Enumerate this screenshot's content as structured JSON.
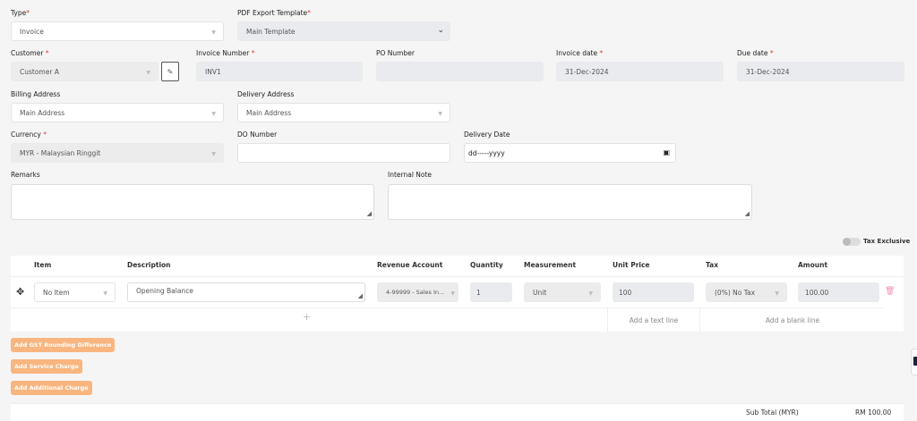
{
  "form": {
    "type": {
      "label": "Type",
      "value": "Invoice"
    },
    "pdf_template": {
      "label": "PDF Export Template",
      "value": "Main Template"
    },
    "customer": {
      "label": "Customer",
      "value": "Customer A"
    },
    "invoice_number": {
      "label": "Invoice Number",
      "value": "INV1"
    },
    "po_number": {
      "label": "PO Number",
      "value": ""
    },
    "invoice_date": {
      "label": "Invoice date",
      "value": "31-Dec-2024"
    },
    "due_date": {
      "label": "Due date",
      "value": "31-Dec-2024"
    },
    "billing_address": {
      "label": "Billing Address",
      "value": "Main Address"
    },
    "delivery_address": {
      "label": "Delivery Address",
      "value": "Main Address"
    },
    "currency": {
      "label": "Currency",
      "value": "MYR - Malaysian Ringgit"
    },
    "do_number": {
      "label": "DO Number",
      "value": ""
    },
    "delivery_date": {
      "label": "Delivery Date",
      "value": "dd-----yyyy"
    },
    "remarks": {
      "label": "Remarks",
      "value": ""
    },
    "internal_note": {
      "label": "Internal Note",
      "value": ""
    },
    "required_mark": "*"
  },
  "tax_toggle": {
    "label": "Tax Exclusive",
    "on": false
  },
  "table": {
    "headers": [
      "Item",
      "Description",
      "Revenue Account",
      "Quantity",
      "Measurement",
      "Unit Price",
      "Tax",
      "Amount"
    ],
    "rows": [
      {
        "item": "No Item",
        "description": "Opening Balance",
        "account": "4-99999 - Sales In...",
        "quantity": "1",
        "measurement": "Unit",
        "unit_price": "100",
        "tax": "(0%) No Tax",
        "amount": "100.00"
      }
    ],
    "add_text_line": "Add a text line",
    "add_blank_line": "Add a blank line"
  },
  "buttons": {
    "gst": "Add GST Rounding Difference",
    "service": "Add Service Charge",
    "additional": "Add Additional Charge"
  },
  "totals": {
    "subtotal_label": "Sub Total (MYR)",
    "subtotal_value": "RM 100.00"
  },
  "colors": {
    "accent": "#f9b57f",
    "required": "#e53935",
    "delete": "#f48fb1"
  }
}
